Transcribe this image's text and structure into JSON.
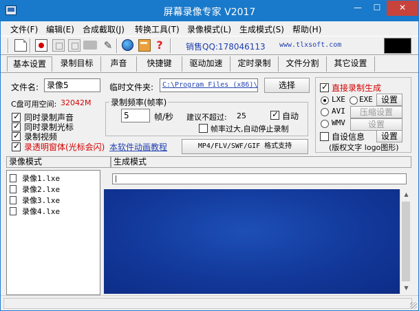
{
  "window": {
    "title": "屏幕录像专家 V2017",
    "controls": {
      "minimize": "—",
      "maximize": "☐",
      "close": "✕"
    }
  },
  "menu": [
    "文件(F)",
    "编辑(E)",
    "合成截取(J)",
    "转换工具(T)",
    "录像模式(L)",
    "生成模式(S)",
    "帮助(H)"
  ],
  "toolbar": {
    "qq": "销售QQ:178046113",
    "url": "www.tlxsoft.com",
    "icons": [
      "new-icon",
      "record-icon",
      "pause-icon",
      "stop-icon",
      "square-icon",
      "camera-icon",
      "pen-icon",
      "globe-icon",
      "package-icon",
      "help-icon"
    ]
  },
  "tabs": [
    "基本设置",
    "录制目标",
    "声音",
    "快捷键",
    "驱动加速",
    "定时录制",
    "文件分割",
    "其它设置"
  ],
  "basic": {
    "filename_label": "文件名:",
    "filename_value": "录像5",
    "tempdir_label": "临时文件夹:",
    "tempdir_value": "C:\\Program Files (x86)\\",
    "select_button": "选择",
    "disk_label": "C盘可用空间:",
    "disk_value": "32042M",
    "checkbox_audio": "同时录制声音",
    "checkbox_cursor": "同时录制光标",
    "checkbox_video": "录制视频",
    "checkbox_transparent": "录透明窗体(光标会闪)",
    "tutorial_link": "本软件动画教程",
    "format_button": "MP4/FLV/SWF/GIF  格式支持",
    "framerate_group": "录制频率(帧率)",
    "framerate_value": "5",
    "framerate_unit": "帧/秒",
    "suggest_label": "建议不超过:",
    "suggest_value": "25",
    "auto_label": "自动",
    "auto_stop_label": "帧率过大,自动停止录制"
  },
  "generate": {
    "direct_label": "直接录制生成",
    "lxe": "LXE",
    "exe": "EXE",
    "avi": "AVI",
    "wmv": "WMV",
    "settings_button": "设置",
    "compress_button": "压缩设置",
    "settings2_button": "设置",
    "custom_info_label": "自设信息",
    "settings3_button": "设置",
    "copyright_label": "(版权文字 logo图形)"
  },
  "lower": {
    "record_mode_header": "录像模式",
    "generate_mode_header": "生成模式",
    "files": [
      "录像1.lxe",
      "录像2.lxe",
      "录像3.lxe",
      "录像4.lxe"
    ]
  },
  "colors": {
    "titlebar": "#1979ca",
    "close_button": "#c7433b",
    "link": "#2040b0",
    "accent_red": "#d40000",
    "preview": "#12389a"
  }
}
